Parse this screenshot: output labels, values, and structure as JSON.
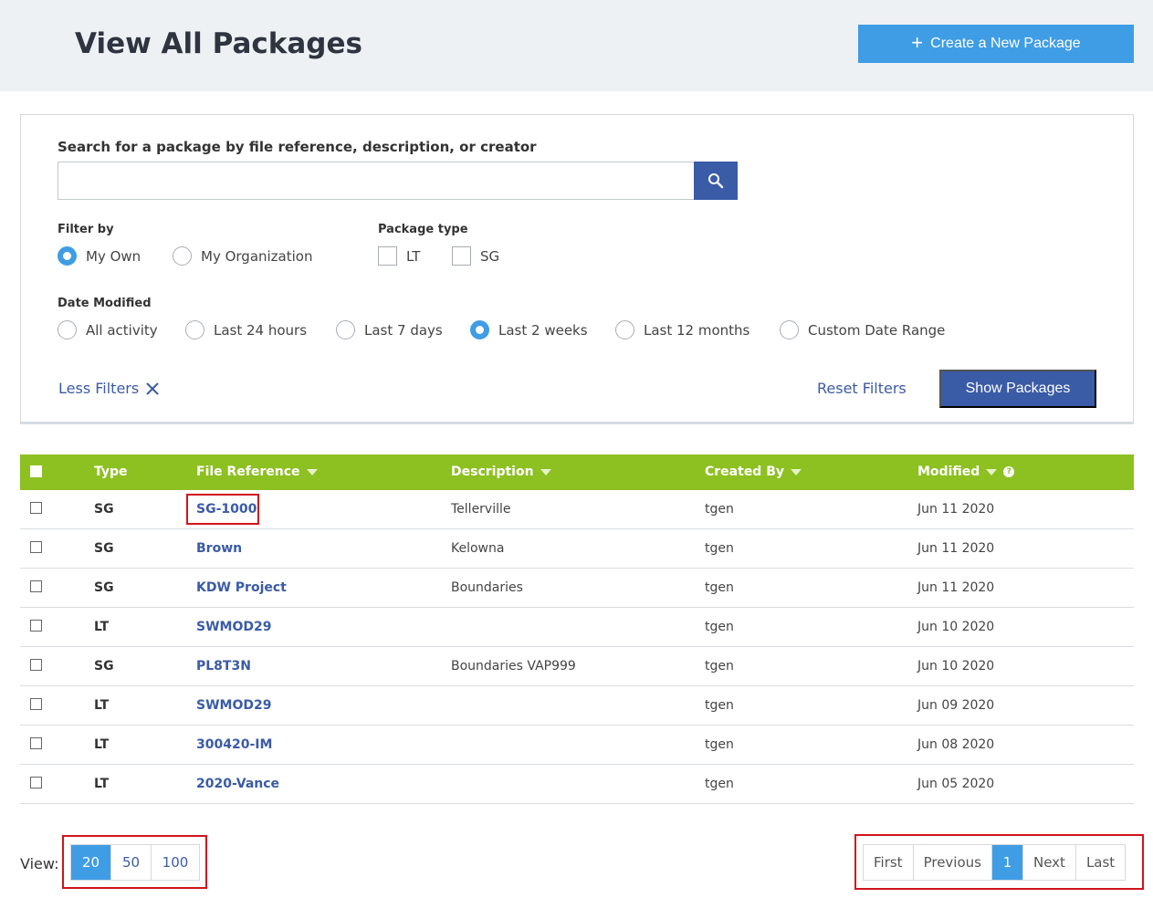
{
  "header": {
    "title": "View All Packages",
    "create_label": "Create a New Package"
  },
  "search": {
    "label": "Search for a package by file reference, description, or creator",
    "value": "",
    "placeholder": ""
  },
  "filters": {
    "filter_by_label": "Filter by",
    "filter_by_options": [
      "My Own",
      "My Organization"
    ],
    "filter_by_selected": "My Own",
    "package_type_label": "Package type",
    "package_type_options": [
      "LT",
      "SG"
    ],
    "date_modified_label": "Date Modified",
    "date_options": [
      "All activity",
      "Last 24 hours",
      "Last 7 days",
      "Last 2 weeks",
      "Last 12 months",
      "Custom Date Range"
    ],
    "date_selected": "Last 2 weeks",
    "less_filters_label": "Less Filters",
    "reset_label": "Reset Filters",
    "show_label": "Show Packages"
  },
  "table": {
    "columns": [
      "Type",
      "File Reference",
      "Description",
      "Created By",
      "Modified"
    ],
    "rows": [
      {
        "type": "SG",
        "file_reference": "SG-1000",
        "description": "Tellerville",
        "created_by": "tgen",
        "modified": "Jun 11 2020"
      },
      {
        "type": "SG",
        "file_reference": "Brown",
        "description": "Kelowna",
        "created_by": "tgen",
        "modified": "Jun 11 2020"
      },
      {
        "type": "SG",
        "file_reference": "KDW Project",
        "description": "Boundaries",
        "created_by": "tgen",
        "modified": "Jun 11 2020"
      },
      {
        "type": "LT",
        "file_reference": "SWMOD29",
        "description": "",
        "created_by": "tgen",
        "modified": "Jun 10 2020"
      },
      {
        "type": "SG",
        "file_reference": "PL8T3N",
        "description": "Boundaries VAP999",
        "created_by": "tgen",
        "modified": "Jun 10 2020"
      },
      {
        "type": "LT",
        "file_reference": "SWMOD29",
        "description": "",
        "created_by": "tgen",
        "modified": "Jun 09 2020"
      },
      {
        "type": "LT",
        "file_reference": "300420-IM",
        "description": "",
        "created_by": "tgen",
        "modified": "Jun 08 2020"
      },
      {
        "type": "LT",
        "file_reference": "2020-Vance",
        "description": "",
        "created_by": "tgen",
        "modified": "Jun 05 2020"
      }
    ]
  },
  "footer": {
    "view_label": "View:",
    "page_sizes": [
      "20",
      "50",
      "100"
    ],
    "page_size_selected": "20",
    "pager": {
      "first": "First",
      "previous": "Previous",
      "current": "1",
      "next": "Next",
      "last": "Last"
    }
  },
  "colors": {
    "accent": "#3f9de5",
    "primary": "#3a5ba6",
    "table_header": "#8dc021",
    "highlight": "#d0141c"
  }
}
